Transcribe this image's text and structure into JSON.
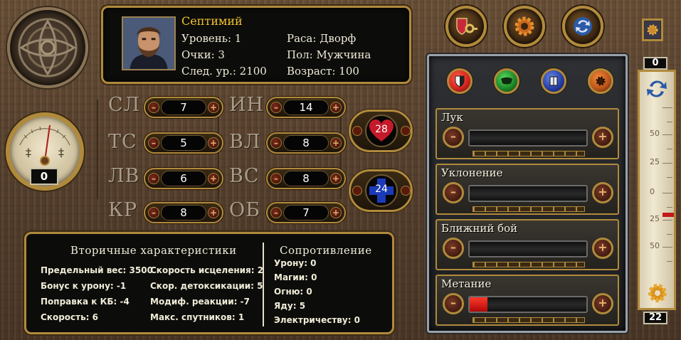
{
  "character": {
    "name": "Септимий",
    "level": "Уровень: 1",
    "points": "Очки: 3",
    "next_level": "След. ур.: 2100",
    "race": "Раса: Дворф",
    "gender": "Пол: Мужчина",
    "age": "Возраст: 100"
  },
  "top_buttons": [
    {
      "icon": "key-icon"
    },
    {
      "icon": "gear-icon"
    },
    {
      "icon": "swap-icon"
    }
  ],
  "gauge": {
    "value": "0"
  },
  "primary_stats": [
    {
      "label": "СЛ",
      "value": "7"
    },
    {
      "label": "ТС",
      "value": "5"
    },
    {
      "label": "ЛВ",
      "value": "6"
    },
    {
      "label": "КР",
      "value": "8"
    },
    {
      "label": "ИН",
      "value": "14"
    },
    {
      "label": "ВЛ",
      "value": "8"
    },
    {
      "label": "ВС",
      "value": "8"
    },
    {
      "label": "ОБ",
      "value": "7"
    }
  ],
  "vitals": {
    "hp": "28",
    "mp": "24"
  },
  "secondary": {
    "title": "Вторичные характеристики",
    "items_left": [
      "Предельный вес: 3500",
      "Бонус к урону: -1",
      "Поправка к КБ: -4",
      "Скорость: 6"
    ],
    "items_right": [
      "Скорость исцеления: 2",
      "Скор. детоксикации: 5",
      "Модиф. реакции: -7",
      "Макс. спутников: 1"
    ]
  },
  "resistance": {
    "title": "Сопротивление",
    "items": [
      "Урону: 0",
      "Магии: 0",
      "Огню: 0",
      "Яду: 5",
      "Электричеству: 0"
    ]
  },
  "skill_tabs": [
    {
      "icon": "shield-icon",
      "color": "#d8261e"
    },
    {
      "icon": "mask-icon",
      "color": "#1f8a2a"
    },
    {
      "icon": "book-icon",
      "color": "#2840a8"
    },
    {
      "icon": "gear-icon",
      "color": "#c0561a"
    }
  ],
  "skills": [
    {
      "name": "Лук",
      "level": 0
    },
    {
      "name": "Уклонение",
      "level": 0
    },
    {
      "name": "Ближний бой",
      "level": 0
    },
    {
      "name": "Метание",
      "level": 0.15
    }
  ],
  "scale": {
    "top_value": "0",
    "bottom_value": "22",
    "ticks": [
      "50",
      "25",
      "0",
      "25",
      "50"
    ]
  }
}
